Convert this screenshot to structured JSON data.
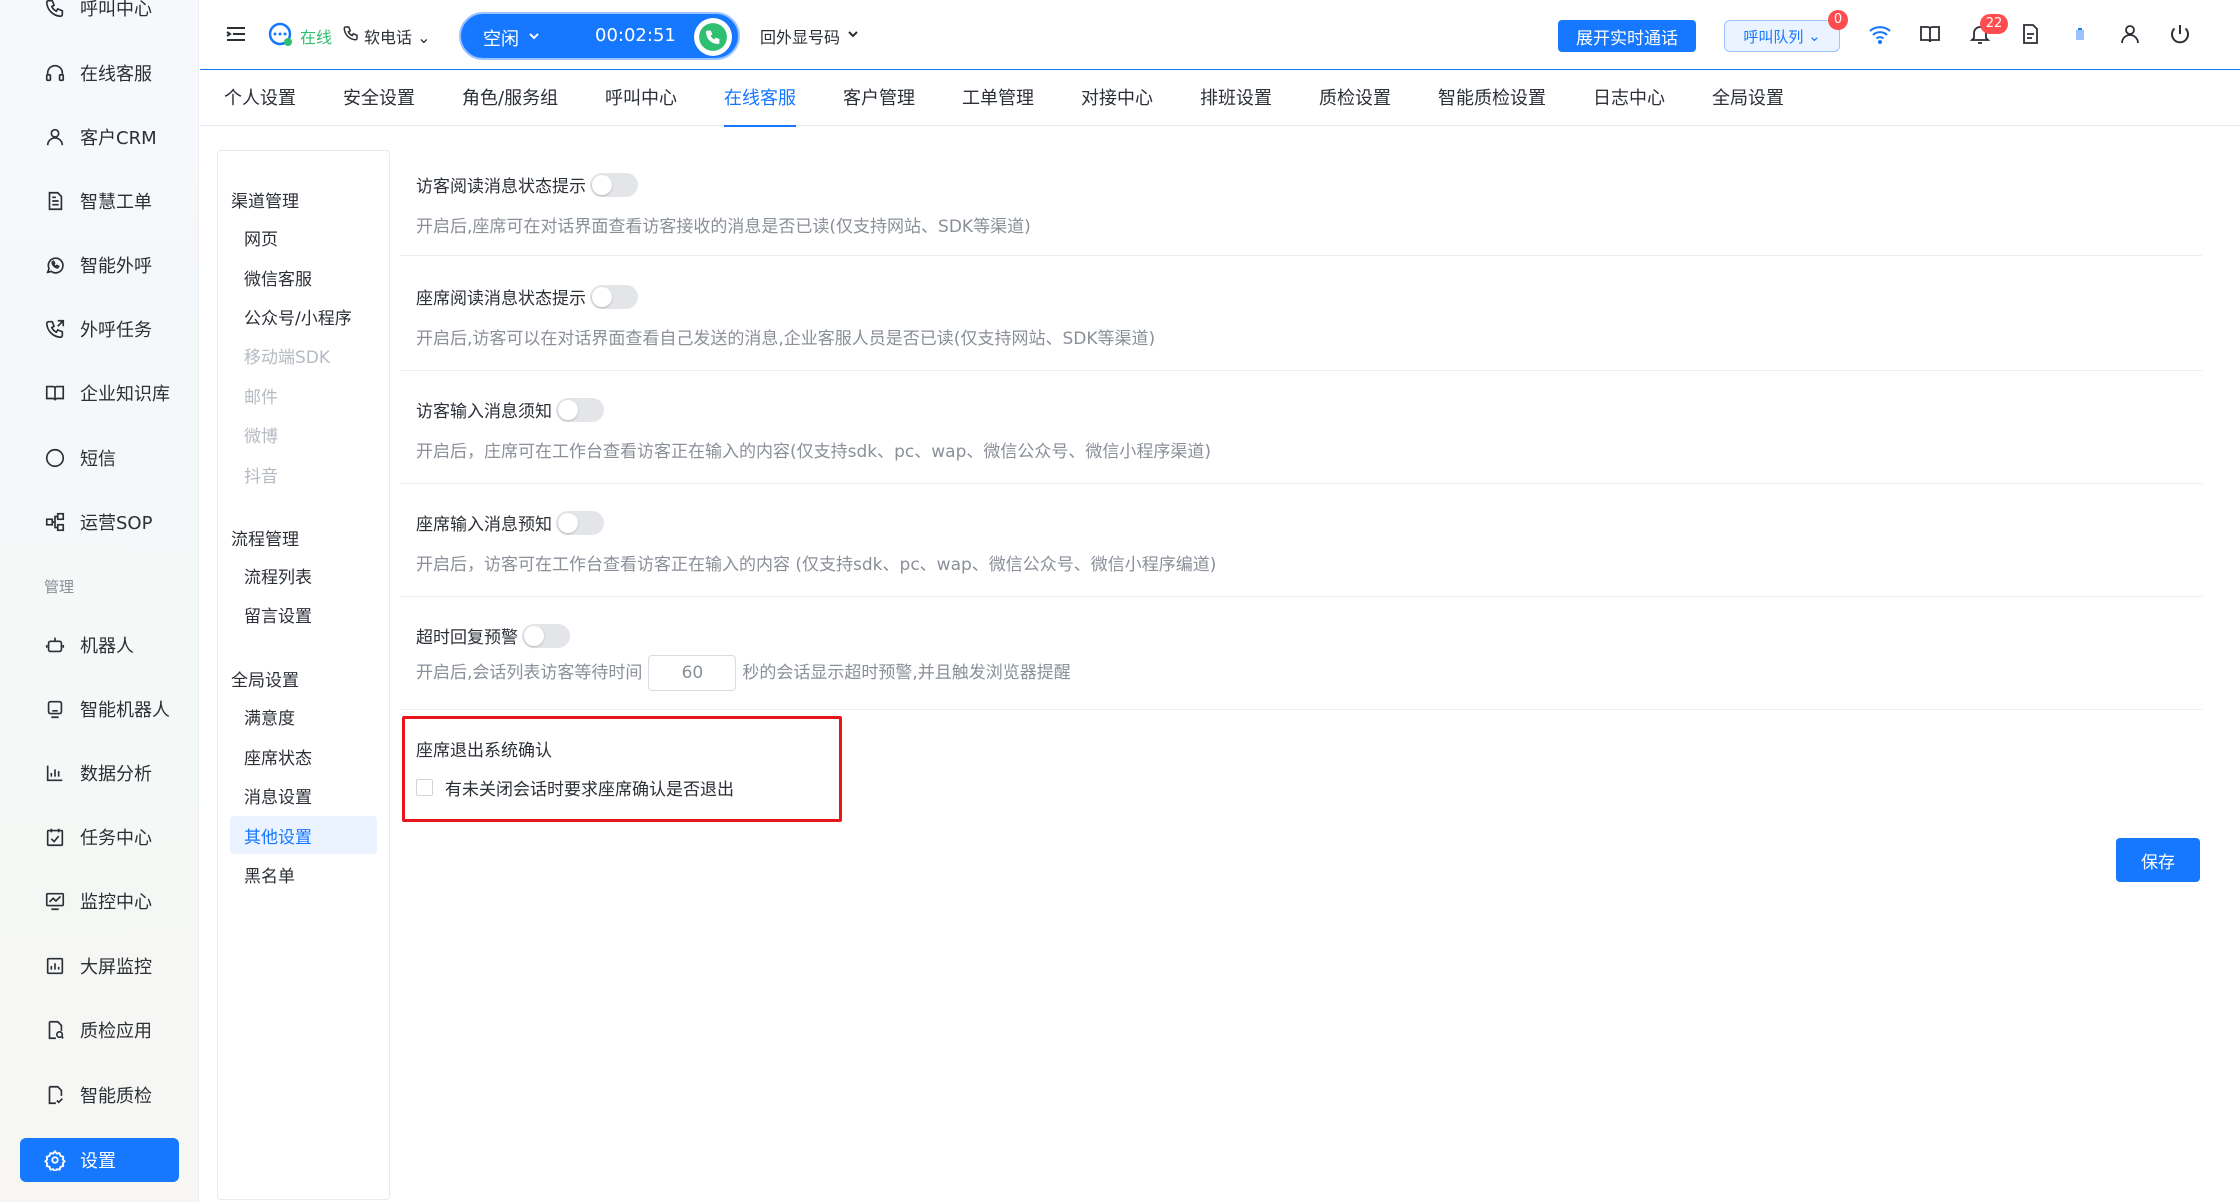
{
  "sidebar": {
    "items": [
      {
        "label": "呼叫中心",
        "icon": "phone-icon"
      },
      {
        "label": "在线客服",
        "icon": "headset-icon"
      },
      {
        "label": "客户CRM",
        "icon": "user-icon"
      },
      {
        "label": "智慧工单",
        "icon": "document-icon"
      },
      {
        "label": "智能外呼",
        "icon": "whatsapp-icon"
      },
      {
        "label": "外呼任务",
        "icon": "phone-outgoing-icon"
      },
      {
        "label": "企业知识库",
        "icon": "book-icon"
      },
      {
        "label": "短信",
        "icon": "sms-icon"
      },
      {
        "label": "运营SOP",
        "icon": "flow-icon"
      },
      {
        "label": "机器人",
        "icon": "robot-icon"
      },
      {
        "label": "智能机器人",
        "icon": "smart-robot-icon"
      },
      {
        "label": "数据分析",
        "icon": "bar-chart-icon"
      },
      {
        "label": "任务中心",
        "icon": "task-icon"
      },
      {
        "label": "监控中心",
        "icon": "monitor-icon"
      },
      {
        "label": "大屏监控",
        "icon": "dashboard-icon"
      },
      {
        "label": "质检应用",
        "icon": "quality-app-icon"
      },
      {
        "label": "智能质检",
        "icon": "quality-check-icon"
      },
      {
        "label": "设置",
        "icon": "gear-icon"
      }
    ],
    "group_manage": "管理"
  },
  "topbar": {
    "status": "在线",
    "phone": "软电话",
    "call_state": "空闲",
    "timer": "00:02:51",
    "outbound": "回外显号码",
    "realtime_button": "展开实时通话",
    "queue_button": "呼叫队列",
    "queue_count": "0",
    "notif_count": "22"
  },
  "tabs": [
    "个人设置",
    "安全设置",
    "角色/服务组",
    "呼叫中心",
    "在线客服",
    "客户管理",
    "工单管理",
    "对接中心",
    "排班设置",
    "质检设置",
    "智能质检设置",
    "日志中心",
    "全局设置"
  ],
  "subnav": {
    "channel_group": "渠道管理",
    "channel_items": [
      "网页",
      "微信客服",
      "公众号/小程序",
      "移动端SDK",
      "邮件",
      "微博",
      "抖音"
    ],
    "flow_group": "流程管理",
    "flow_items": [
      "流程列表",
      "留言设置"
    ],
    "global_group": "全局设置",
    "global_items": [
      "满意度",
      "座席状态",
      "消息设置",
      "其他设置",
      "黑名单"
    ]
  },
  "settings": [
    {
      "title": "访客阅读消息状态提示",
      "desc": "开启后,座席可在对话界面查看访客接收的消息是否已读(仅支持网站、SDK等渠道)"
    },
    {
      "title": "座席阅读消息状态提示",
      "desc": "开启后,访客可以在对话界面查看自己发送的消息,企业客服人员是否已读(仅支持网站、SDK等渠道)"
    },
    {
      "title": "访客输入消息须知",
      "desc": "开启后，庄席可在工作台查看访客正在输入的内容(仅支持sdk、pc、wap、微信公众号、微信小程序渠道)"
    },
    {
      "title": "座席输入消息预知",
      "desc": "开启后，访客可在工作台查看访客正在输入的内容 (仅支持sdk、pc、wap、微信公众号、微信小程序编道)"
    },
    {
      "title": "超时回复预警",
      "desc_before": "开启后,会话列表访客等待时间",
      "value": "60",
      "desc_after": "秒的会话显示超时预警,并且触发浏览器提醒"
    }
  ],
  "confirm": {
    "title": "座席退出系统确认",
    "checkbox_label": "有未关闭会话时要求座席确认是否退出"
  },
  "save_button": "保存",
  "colors": {
    "accent": "#1677ff",
    "highlight": "#e8161b",
    "online": "#2fbf71"
  }
}
